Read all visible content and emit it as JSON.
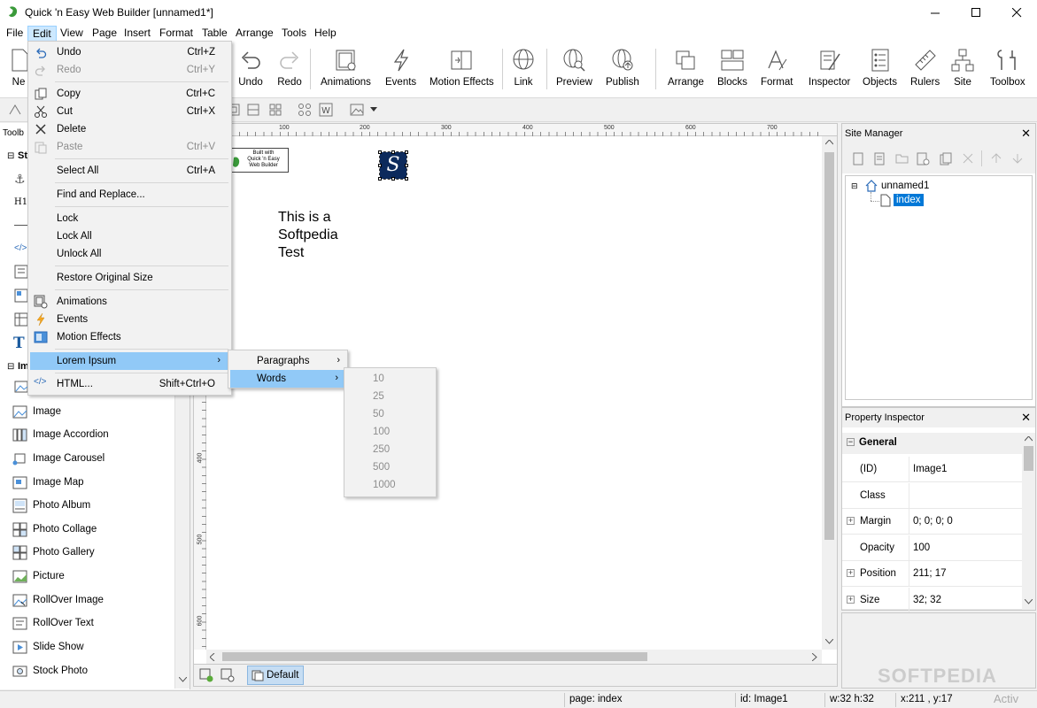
{
  "window": {
    "title": "Quick 'n Easy Web Builder [unnamed1*]",
    "colors": {
      "accent": "#0078d7",
      "menu_highlight": "#91c9f7",
      "selection": "#0078d7"
    }
  },
  "menubar": [
    "File",
    "Edit",
    "View",
    "Page",
    "Insert",
    "Format",
    "Table",
    "Arrange",
    "Tools",
    "Help"
  ],
  "ribbon": {
    "new_partial": "Ne",
    "buttons": [
      "Undo",
      "Redo",
      "Animations",
      "Events",
      "Motion Effects",
      "Link",
      "Preview",
      "Publish",
      "Arrange",
      "Blocks",
      "Format",
      "Inspector",
      "Objects",
      "Rulers",
      "Site",
      "Toolbox"
    ]
  },
  "left_panel": {
    "title_partial": "Toolb",
    "group1_partial": "St",
    "group2_partial": "Im",
    "h1_partial": "H1",
    "items": [
      "Image",
      "Image Accordion",
      "Image Carousel",
      "Image Map",
      "Photo Album",
      "Photo Collage",
      "Photo Gallery",
      "Picture",
      "RollOver Image",
      "RollOver Text",
      "Slide Show",
      "Stock Photo"
    ]
  },
  "canvas": {
    "ruler_h": [
      "100",
      "200",
      "300",
      "400",
      "500",
      "600",
      "700"
    ],
    "ruler_v": [
      "400",
      "500",
      "600"
    ],
    "badge_line1": "Built with",
    "badge_line2": "Quick 'n Easy",
    "badge_line3": "Web Builder",
    "text_line1": "This is a",
    "text_line2": "Softpedia",
    "text_line3": "Test",
    "logo_letter": "S",
    "bottom_tab": "Default"
  },
  "edit_menu": {
    "items": [
      {
        "label": "Undo",
        "shortcut": "Ctrl+Z",
        "disabled": false
      },
      {
        "label": "Redo",
        "shortcut": "Ctrl+Y",
        "disabled": true
      },
      {
        "label": "Copy",
        "shortcut": "Ctrl+C",
        "disabled": false
      },
      {
        "label": "Cut",
        "shortcut": "Ctrl+X",
        "disabled": false
      },
      {
        "label": "Delete",
        "shortcut": "",
        "disabled": false
      },
      {
        "label": "Paste",
        "shortcut": "Ctrl+V",
        "disabled": true
      },
      {
        "label": "Select All",
        "shortcut": "Ctrl+A",
        "disabled": false
      },
      {
        "label": "Find and Replace...",
        "shortcut": "",
        "disabled": false
      },
      {
        "label": "Lock",
        "shortcut": "",
        "disabled": false
      },
      {
        "label": "Lock All",
        "shortcut": "",
        "disabled": false
      },
      {
        "label": "Unlock All",
        "shortcut": "",
        "disabled": false
      },
      {
        "label": "Restore Original Size",
        "shortcut": "",
        "disabled": false
      },
      {
        "label": "Animations",
        "shortcut": "",
        "disabled": false
      },
      {
        "label": "Events",
        "shortcut": "",
        "disabled": false
      },
      {
        "label": "Motion Effects",
        "shortcut": "",
        "disabled": false
      },
      {
        "label": "Lorem Ipsum",
        "shortcut": "",
        "disabled": false
      },
      {
        "label": "HTML...",
        "shortcut": "Shift+Ctrl+O",
        "disabled": false
      }
    ]
  },
  "lorem_submenu": [
    "Paragraphs",
    "Words"
  ],
  "words_submenu": [
    "10",
    "25",
    "50",
    "100",
    "250",
    "500",
    "1000"
  ],
  "site_manager": {
    "title": "Site Manager",
    "root": "unnamed1",
    "page": "index"
  },
  "property_inspector": {
    "title": "Property Inspector",
    "group": "General",
    "rows": [
      {
        "key": "(ID)",
        "value": "Image1",
        "expandable": false
      },
      {
        "key": "Class",
        "value": "",
        "expandable": false
      },
      {
        "key": "Margin",
        "value": "0; 0; 0; 0",
        "expandable": true
      },
      {
        "key": "Opacity",
        "value": "100",
        "expandable": false
      },
      {
        "key": "Position",
        "value": "211; 17",
        "expandable": true
      },
      {
        "key": "Size",
        "value": "32; 32",
        "expandable": true
      }
    ]
  },
  "statusbar": {
    "page": "page: index",
    "id": "id: Image1",
    "size": "w:32 h:32",
    "coords": "x:211 , y:17"
  },
  "watermark": "SOFTPEDIA",
  "activation_partial": "Activ"
}
